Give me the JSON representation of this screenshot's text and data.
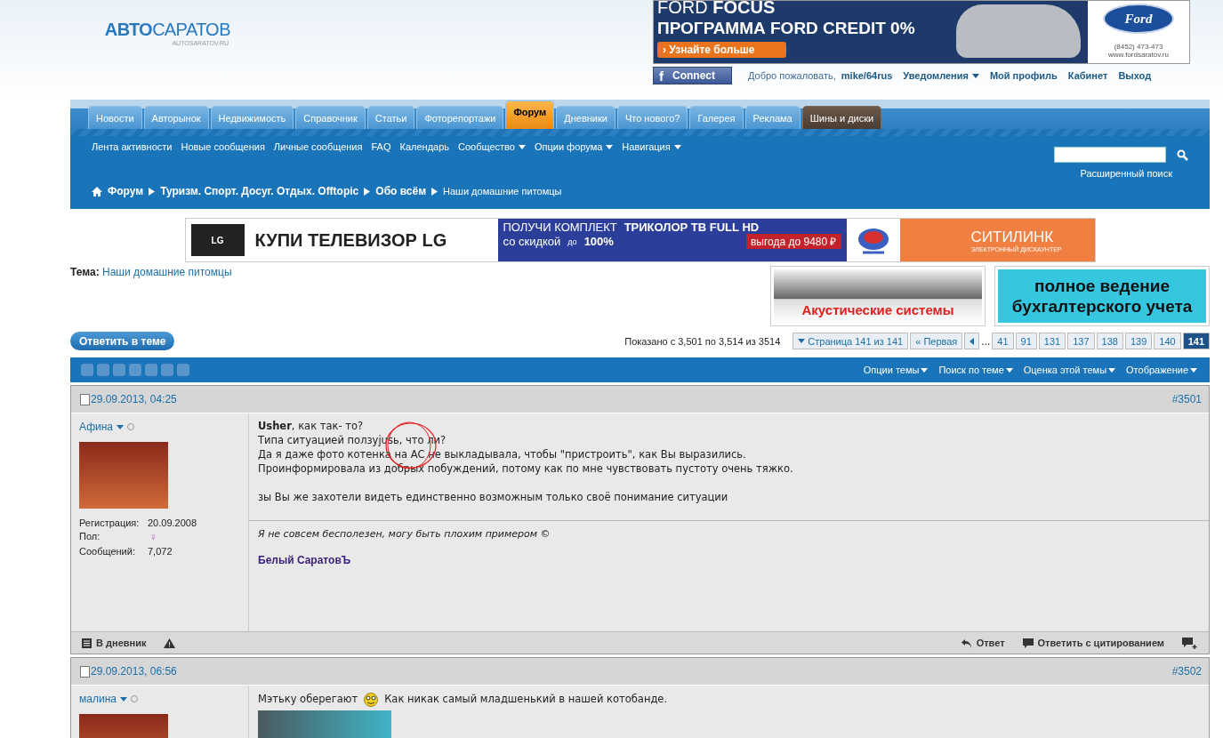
{
  "logo": {
    "main": "АВТО",
    "accent": "САРАТОВ",
    "domain": "AUTOSARATOV.RU"
  },
  "top_banner": {
    "headline_light": "FORD",
    "headline_bold": "FOCUS",
    "line": "ПРОГРАММА FORD CREDIT 0%",
    "button": "Узнайте больше",
    "button_icon": "›",
    "brand": "Ford",
    "phone": "(8452) 473-473",
    "site": "www.fordsaratov.ru"
  },
  "user_bar": {
    "connect_icon": "f",
    "connect": "Connect",
    "welcome": "Добро пожаловать,",
    "username": "mike/64rus",
    "links": [
      {
        "label": "Уведомления",
        "dropdown": true
      },
      {
        "label": "Мой профиль",
        "dropdown": false
      },
      {
        "label": "Кабинет",
        "dropdown": false
      },
      {
        "label": "Выход",
        "dropdown": false
      }
    ]
  },
  "tabs": [
    {
      "label": "Новости",
      "selected": false,
      "kind": "tab"
    },
    {
      "label": "Авторынок",
      "selected": false,
      "kind": "tab"
    },
    {
      "label": "Недвижимость",
      "selected": false,
      "kind": "tab"
    },
    {
      "label": "Справочник",
      "selected": false,
      "kind": "tab"
    },
    {
      "label": "Статьи",
      "selected": false,
      "kind": "tab"
    },
    {
      "label": "Фоторепортажи",
      "selected": false,
      "kind": "tab"
    },
    {
      "label": "Форум",
      "selected": true,
      "kind": "tab"
    },
    {
      "label": "Дневники",
      "selected": false,
      "kind": "tab"
    },
    {
      "label": "Что нового?",
      "selected": false,
      "kind": "tab"
    },
    {
      "label": "Галерея",
      "selected": false,
      "kind": "tab"
    },
    {
      "label": "Реклама",
      "selected": false,
      "kind": "tab"
    },
    {
      "label": "Шины и диски",
      "selected": false,
      "kind": "partner"
    }
  ],
  "subnav": [
    {
      "label": "Лента активности",
      "dropdown": false
    },
    {
      "label": "Новые сообщения",
      "dropdown": false
    },
    {
      "label": "Личные сообщения",
      "dropdown": false
    },
    {
      "label": "FAQ",
      "dropdown": false
    },
    {
      "label": "Календарь",
      "dropdown": false
    },
    {
      "label": "Сообщество",
      "dropdown": true
    },
    {
      "label": "Опции форума",
      "dropdown": true
    },
    {
      "label": "Навигация",
      "dropdown": true
    }
  ],
  "search": {
    "advanced": "Расширенный поиск"
  },
  "breadcrumbs": [
    {
      "label": "Форум",
      "current": false
    },
    {
      "label": "Туризм. Спорт. Досуг. Отдых. Offtopic",
      "current": false
    },
    {
      "label": "Обо всём",
      "current": false
    },
    {
      "label": "Наши домашние питомцы",
      "current": true
    }
  ],
  "ad_banner": {
    "left": "КУПИ ТЕЛЕВИЗОР LG",
    "lg": "LG",
    "mid_top_light": "ПОЛУЧИ КОМПЛЕКТ",
    "mid_top_bold": "ТРИКОЛОР ТВ FULL HD",
    "mid_bottom": "со скидкой",
    "mid_until": "до",
    "mid_percent": "100%",
    "badge": "выгода до 9480 ₽",
    "right": "СИТИЛИНК",
    "right_sub": "ЭЛЕКТРОННЫЙ ДИСКАУНТЕР"
  },
  "thread": {
    "label": "Тема:",
    "title": "Наши домашние питомцы"
  },
  "side_ads": [
    {
      "text": "Акустические системы",
      "kind": "car"
    },
    {
      "text": "полное ведение бухгалтерского учета",
      "kind": "text"
    }
  ],
  "reply_button": "Ответить в теме",
  "pagination": {
    "summary": "Показано с 3,501 по 3,514 из 3514",
    "jump": "Страница 141 из 141",
    "first_icon": "«",
    "first": "Первая",
    "ellipsis": "...",
    "pages": [
      {
        "label": "41",
        "selected": false
      },
      {
        "label": "91",
        "selected": false
      },
      {
        "label": "131",
        "selected": false
      },
      {
        "label": "137",
        "selected": false
      },
      {
        "label": "138",
        "selected": false
      },
      {
        "label": "139",
        "selected": false
      },
      {
        "label": "140",
        "selected": false
      },
      {
        "label": "141",
        "selected": true
      }
    ]
  },
  "thread_toolbar": {
    "menus": [
      "Опции темы",
      "Поиск по теме",
      "Оценка этой темы",
      "Отображение"
    ]
  },
  "posts": [
    {
      "date": "29.09.2013, 04:25",
      "number": "#3501",
      "author": "Афина",
      "online": false,
      "stats": [
        {
          "label": "Регистрация:",
          "value": "20.09.2008",
          "kind": "text"
        },
        {
          "label": "Пол:",
          "value": "♀",
          "kind": "symbol"
        },
        {
          "label": "Сообщений:",
          "value": "7,072",
          "kind": "text"
        }
      ],
      "paragraphs": [
        [
          {
            "text": "**Usher**, как так- то?"
          },
          {
            "text": "Типа ситуацией ползуjusь, что ли?"
          },
          {
            "text": "Да я даже фото котенка на АС не выкладывала, чтобы \"пристроить\", как Вы выразились."
          },
          {
            "text": "Проинформировала из добрых побуждений, потому как по мне чувствовать пустоту очень тяжко."
          }
        ],
        [
          {
            "text": "зы Вы же захотели видеть единственно возможным только своё понимание ситуации"
          }
        ]
      ],
      "annotated": true,
      "signature": {
        "quote": "Я не совсем бесполезен, могу быть плохим примером ©",
        "name": "Белый СаратовЪ"
      },
      "actions": {
        "diary": "В дневник",
        "reply": "Ответ",
        "quote": "Ответить с цитированием"
      }
    },
    {
      "date": "29.09.2013, 06:56",
      "number": "#3502",
      "author": "малина",
      "online": false,
      "paragraphs": [
        [
          {
            "text": "Мэтьку оберегают",
            "smiley": true,
            "after": "Как никак самый младшенький в нашей котобанде."
          }
        ]
      ],
      "annotated": false,
      "image": true
    }
  ]
}
